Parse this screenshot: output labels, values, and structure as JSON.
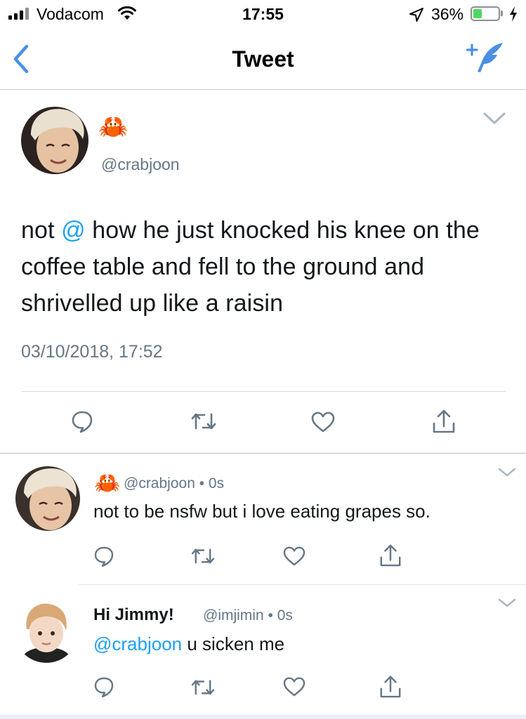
{
  "status_bar": {
    "carrier": "Vodacom",
    "time": "17:55",
    "battery_percent": "36%",
    "battery_level": 0.36,
    "signal_bars": 4,
    "icons": [
      "signal-icon",
      "wifi-icon",
      "location-arrow-icon",
      "battery-icon",
      "charging-bolt-icon"
    ]
  },
  "nav": {
    "title": "Tweet",
    "back_icon": "back-chevron-icon",
    "compose_icon": "compose-tweet-icon"
  },
  "main_tweet": {
    "display_name_emoji": "🦀",
    "handle": "@crabjoon",
    "text_before": "not ",
    "mention": "@",
    "text_after": " how he just knocked his knee on the coffee table and fell to the ground and shrivelled up like a raisin",
    "timestamp": "03/10/2018, 17:52",
    "actions": [
      "reply-icon",
      "retweet-icon",
      "like-icon",
      "share-icon"
    ]
  },
  "replies": [
    {
      "display_name_emoji": "🦀",
      "handle": "@crabjoon",
      "dot": "•",
      "time": "0s",
      "text": "not to be nsfw but i love eating grapes so."
    },
    {
      "display_name": "Hi Jimmy!",
      "handle": "@imjimin",
      "dot": "•",
      "time": "0s",
      "mention": "@crabjoon",
      "text": " u sicken me"
    }
  ],
  "colors": {
    "accent": "#1da1f2",
    "nav_icon": "#4a90e2",
    "secondary_text": "#657786",
    "battery_fill": "#4cd964"
  }
}
